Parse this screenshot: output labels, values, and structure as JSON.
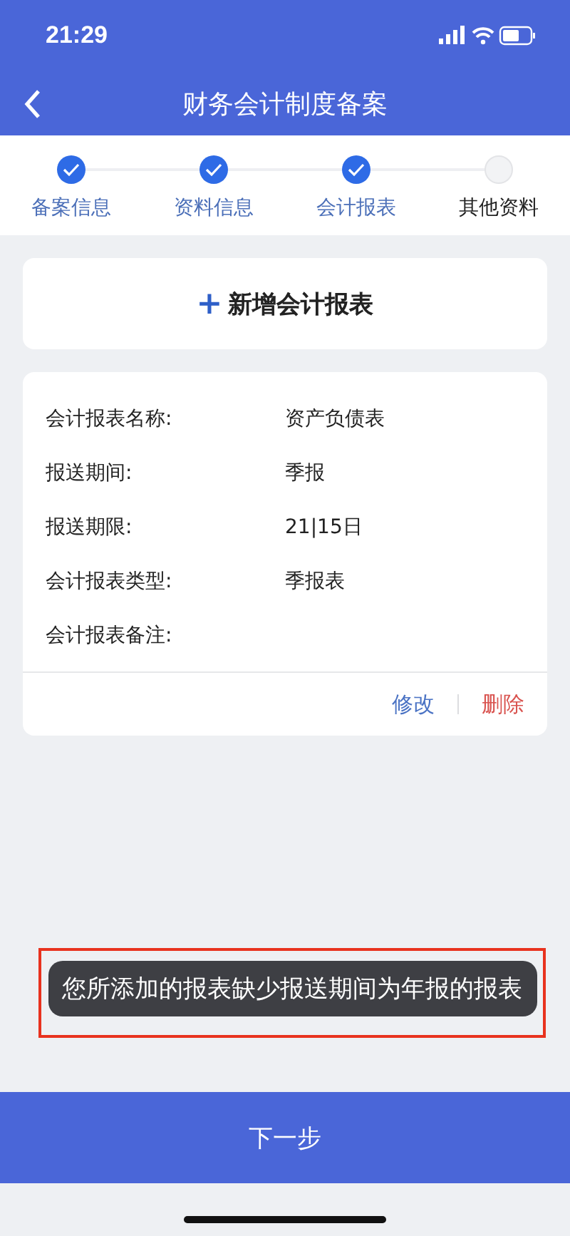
{
  "status_bar": {
    "time": "21:29"
  },
  "nav": {
    "title": "财务会计制度备案"
  },
  "steps": [
    {
      "label": "备案信息",
      "completed": true
    },
    {
      "label": "资料信息",
      "completed": true
    },
    {
      "label": "会计报表",
      "completed": true
    },
    {
      "label": "其他资料",
      "completed": false
    }
  ],
  "add_button": {
    "icon": "+",
    "label": "新增会计报表"
  },
  "report_card": {
    "fields": [
      {
        "label": "会计报表名称:",
        "value": "资产负债表"
      },
      {
        "label": "报送期间:",
        "value": "季报"
      },
      {
        "label": "报送期限:",
        "value": "21|15日"
      },
      {
        "label": "会计报表类型:",
        "value": "季报表"
      },
      {
        "label": "会计报表备注:"
      }
    ],
    "actions": [
      {
        "label": "修改",
        "kind": "edit"
      },
      {
        "label": "删除",
        "kind": "delete"
      }
    ]
  },
  "toast": {
    "text": "您所添加的报表缺少报送期间为年报的报表",
    "highlighted": true
  },
  "next_button": {
    "label": "下一步"
  }
}
